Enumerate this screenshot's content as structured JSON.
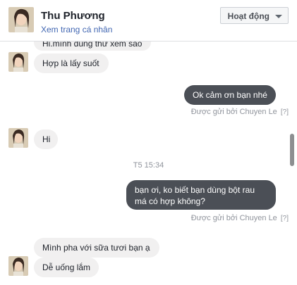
{
  "header": {
    "name": "Thu Phương",
    "profile_link": "Xem trang cá nhân",
    "activity_button": "Hoạt động"
  },
  "messages": {
    "m0": "Hi.mình dùng thử xem sao",
    "m1": "Hợp là lấy suốt",
    "m2": "Ok cảm ơn bạn nhé",
    "m3": "Hi",
    "m4": "bạn ơi, ko biết bạn dùng bột rau má có hợp không?",
    "m5": "Mình pha với sữa tươi bạn ạ",
    "m6": "Dễ uống lắm"
  },
  "sent_by": "Được gửi bởi Chuyen Le",
  "help_mark": "[?]",
  "timestamp": "T5 15:34",
  "colors": {
    "incoming_bubble": "#f1f0f0",
    "outgoing_bubble": "#4b4f56",
    "link": "#4267b2"
  }
}
